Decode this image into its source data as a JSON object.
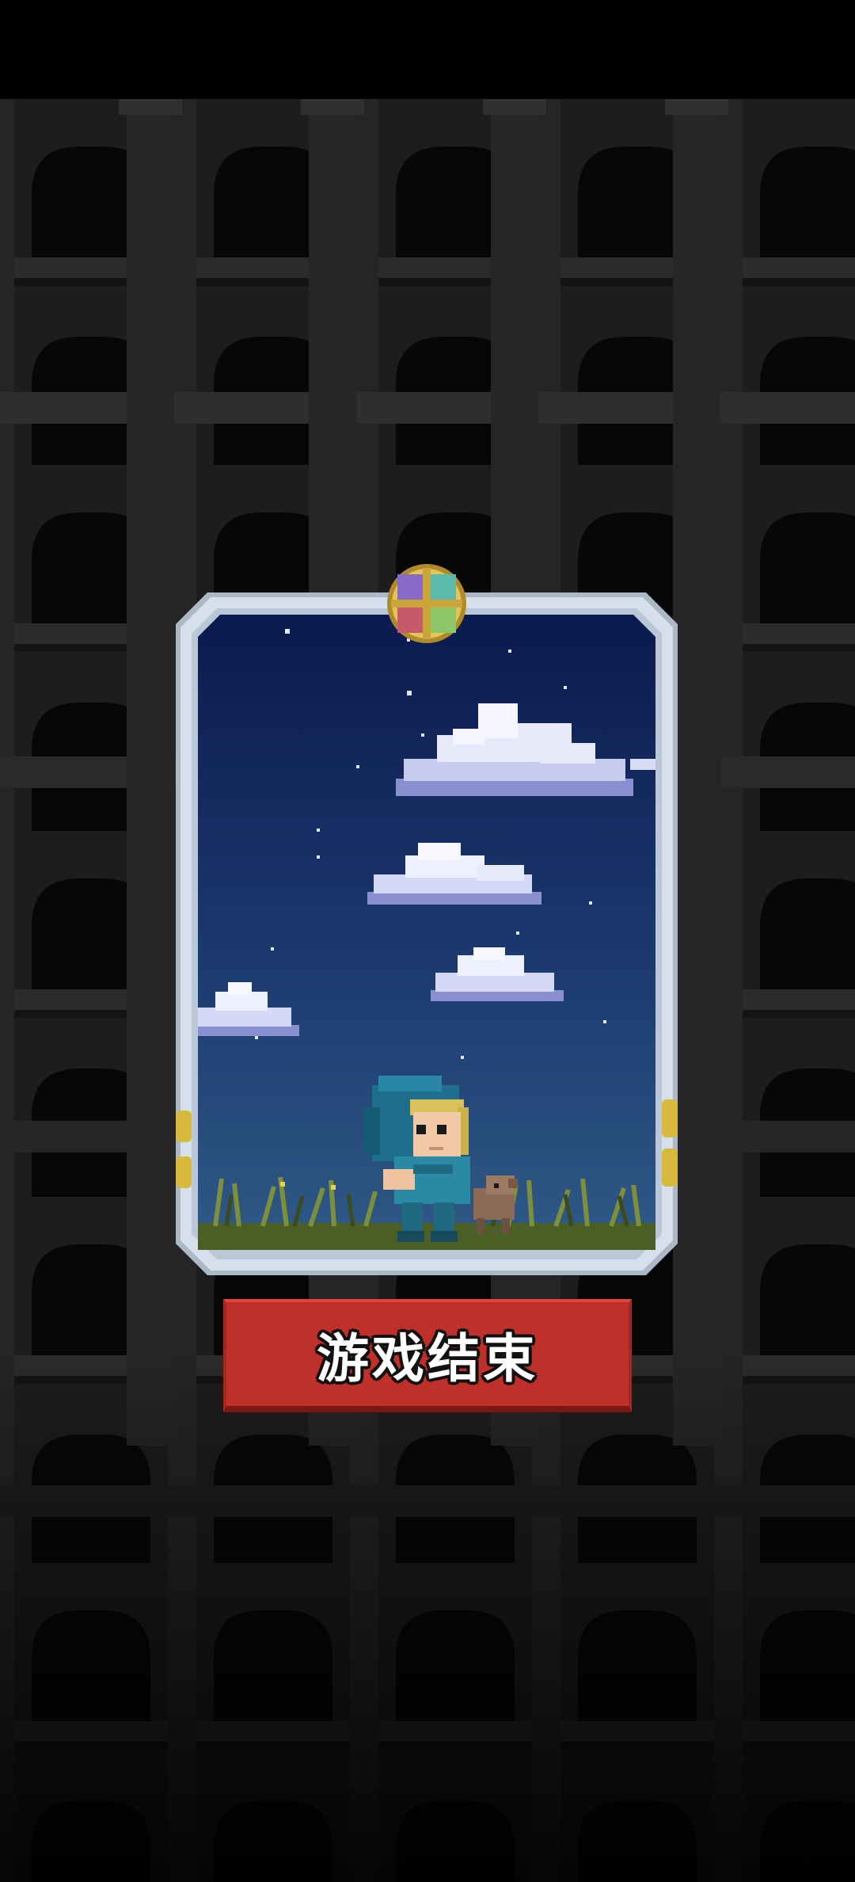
{
  "screen": {
    "name": "game-over-screen"
  },
  "card": {
    "scene": "night-sky-with-clouds",
    "character": "hooded-hero-with-dog"
  },
  "buttons": {
    "game_over_label": "游戏结束"
  },
  "colors": {
    "button_red": "#c0302a",
    "sky_top": "#0b1a4f",
    "sky_bottom": "#2f5a87",
    "frame": "#c9d6e3",
    "background": "#1c1c1c"
  }
}
